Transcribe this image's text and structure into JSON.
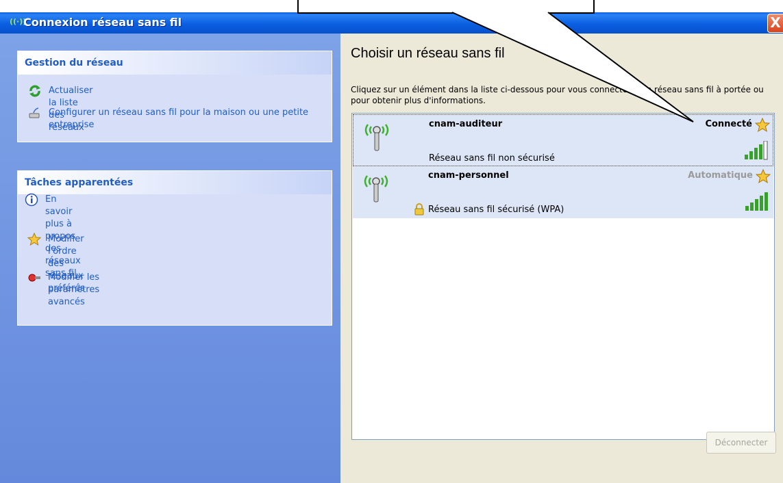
{
  "window": {
    "title": "Connexion réseau sans fil",
    "close_label": "X",
    "title_icon": "((·))"
  },
  "left": {
    "network_panel": {
      "heading": "Gestion du réseau",
      "tasks": [
        {
          "label": "Actualiser la liste des réseaux",
          "icon": "refresh-icon"
        },
        {
          "label": "Configurer un réseau sans fil pour la maison ou une petite entreprise",
          "icon": "wizard-icon"
        }
      ]
    },
    "related_panel": {
      "heading": "Tâches apparentées",
      "tasks": [
        {
          "label": "En savoir plus à propos des réseaux sans fil",
          "icon": "info-icon"
        },
        {
          "label": "Modifier l'ordre des réseaux préférés",
          "icon": "star-icon"
        },
        {
          "label": "Modifier les paramètres avancés",
          "icon": "settings-icon"
        }
      ]
    }
  },
  "main": {
    "title": "Choisir un réseau sans fil",
    "description": "Cliquez sur un élément dans la liste ci-dessous pour vous connecter à un réseau sans fil à portée ou pour obtenir plus d'informations.",
    "networks": [
      {
        "name": "cnam-auditeur",
        "status": "Connecté",
        "security": "Réseau sans fil non sécurisé",
        "selected": true
      },
      {
        "name": "cnam-personnel",
        "status": "Automatique",
        "security": "Réseau sans fil sécurisé (WPA)",
        "selected": false
      }
    ],
    "disconnect_label": "Déconnecter"
  },
  "colors": {
    "titlebar": "#0a5fe0",
    "link": "#215dc6",
    "signal": "#3aa02c"
  }
}
